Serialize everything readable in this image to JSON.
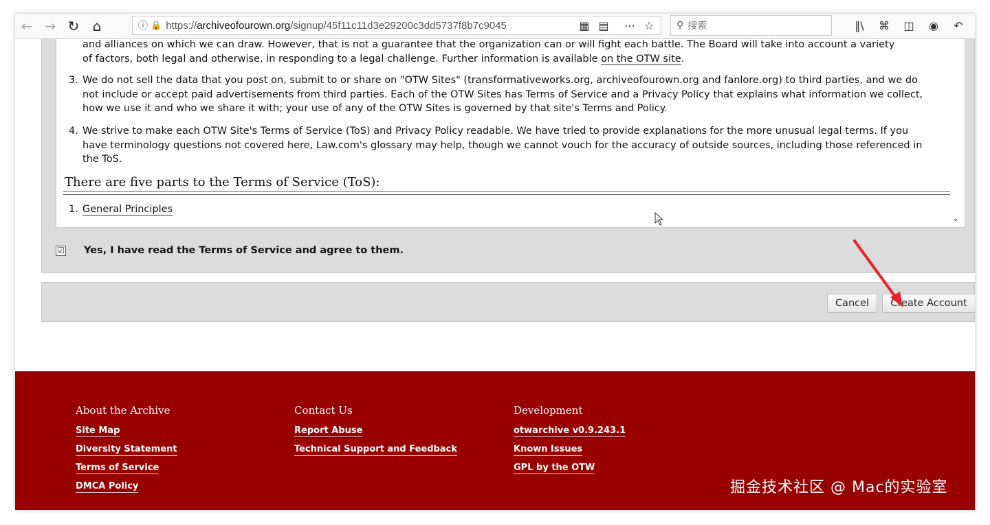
{
  "browser": {
    "url_prefix": "https://",
    "url_host": "archiveofourown.org",
    "url_path": "/signup/45f11c11d3e29200c3dd5737f8b7c9045",
    "search_placeholder": "搜索",
    "icons": [
      "back-icon",
      "forward-icon",
      "reload-icon",
      "home-icon",
      "info-icon",
      "lock-icon",
      "qr-icon",
      "reader-icon",
      "more-icon",
      "star-icon",
      "search-icon",
      "library-icon",
      "crop-icon",
      "sidebar-icon",
      "extension-icon",
      "undo-icon"
    ]
  },
  "tos": {
    "item2_tail_line1": "and alliances on which we can draw. However, that is not a guarantee that the organization can or will fight each battle. The Board will take into account a variety",
    "item2_tail_line2_a": "of factors, both legal and otherwise, in responding to a legal challenge. Further information is available ",
    "item2_tail_link": "on the OTW site",
    "item2_tail_end": ".",
    "item3_num": "3.",
    "item3_text": "We do not sell the data that you post on, submit to or share on \"OTW Sites\" (transformativeworks.org, archiveofourown.org and fanlore.org) to third parties, and we do not include or accept paid advertisements from third parties. Each of the OTW Sites has Terms of Service and a Privacy Policy that explains what information we collect, how we use it and who we share it with; your use of any of the OTW Sites is governed by that site's Terms and Policy.",
    "item4_num": "4.",
    "item4_text": "We strive to make each OTW Site's Terms of Service (ToS) and Privacy Policy readable. We have tried to provide explanations for the more unusual legal terms. If you have terminology questions not covered here, Law.com's glossary may help, though we cannot vouch for the accuracy of outside sources, including those referenced in the ToS.",
    "parts_heading": "There are five parts to the Terms of Service (ToS):",
    "part1_num": "1.",
    "part1_link": "General Principles"
  },
  "agree": {
    "checked": true,
    "check_mark": "☑",
    "label": "Yes, I have read the Terms of Service and agree to them."
  },
  "actions": {
    "cancel_label": "Cancel",
    "create_label": "Create Account"
  },
  "footer": {
    "columns": [
      {
        "heading": "About the Archive",
        "links": [
          "Site Map",
          "Diversity Statement",
          "Terms of Service",
          "DMCA Policy"
        ]
      },
      {
        "heading": "Contact Us",
        "links": [
          "Report Abuse",
          "Technical Support and Feedback"
        ]
      },
      {
        "heading": "Development",
        "links": [
          "otwarchive v0.9.243.1",
          "Known Issues",
          "GPL by the OTW"
        ]
      }
    ]
  },
  "watermark": "掘金技术社区 @ Mac的实验室",
  "colors": {
    "footer_bg": "#990000",
    "arrow": "#e8202a",
    "panel_bg": "#dcdcdc"
  }
}
